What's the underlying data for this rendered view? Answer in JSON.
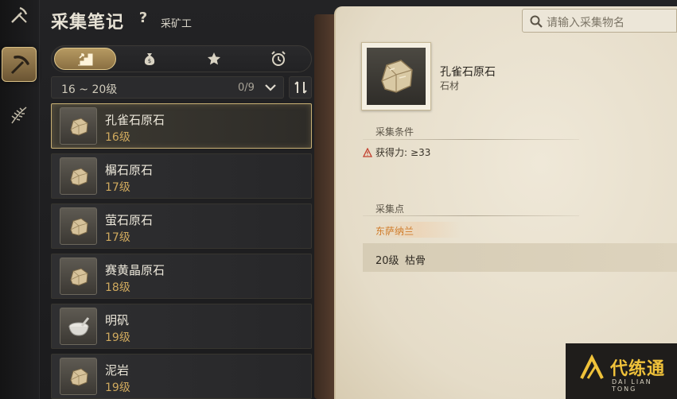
{
  "header": {
    "title": "采集笔记",
    "help": "?",
    "profession": "采矿工"
  },
  "rail": {
    "items": [
      {
        "icon": "pickaxe-icon",
        "active": true
      },
      {
        "icon": "herb-leaf-icon",
        "active": false
      }
    ]
  },
  "tabs": [
    {
      "icon": "level-stairs-icon",
      "active": true
    },
    {
      "icon": "money-bag-icon",
      "active": false
    },
    {
      "icon": "star-icon",
      "active": false
    },
    {
      "icon": "alarm-clock-icon",
      "active": false
    }
  ],
  "filter": {
    "range": "16 ~ 20级",
    "count": "0/9"
  },
  "items": [
    {
      "name": "孔雀石原石",
      "level": "16级",
      "icon": "ore-icon",
      "selected": true
    },
    {
      "name": "榍石原石",
      "level": "17级",
      "icon": "ore-icon",
      "selected": false
    },
    {
      "name": "萤石原石",
      "level": "17级",
      "icon": "ore-icon",
      "selected": false
    },
    {
      "name": "赛黄晶原石",
      "level": "18级",
      "icon": "ore-icon",
      "selected": false
    },
    {
      "name": "明矾",
      "level": "19级",
      "icon": "mortar-icon",
      "selected": false
    },
    {
      "name": "泥岩",
      "level": "19级",
      "icon": "ore-icon",
      "selected": false
    }
  ],
  "search": {
    "placeholder": "请输入采集物名"
  },
  "detail": {
    "name": "孔雀石原石",
    "type": "石材",
    "condition_header": "采集条件",
    "condition_label": "获得力:",
    "condition_value": "≥33",
    "points_header": "采集点",
    "region": "东萨纳兰",
    "spot_level": "20级",
    "spot_monster": "枯骨"
  },
  "watermark": {
    "title": "代练通",
    "subtitle": "DAI LIAN TONG"
  },
  "colors": {
    "accent": "#c8b074",
    "level_text": "#cfa95e",
    "region_text": "#d07c2a",
    "parchment": "#e9e1cf"
  }
}
